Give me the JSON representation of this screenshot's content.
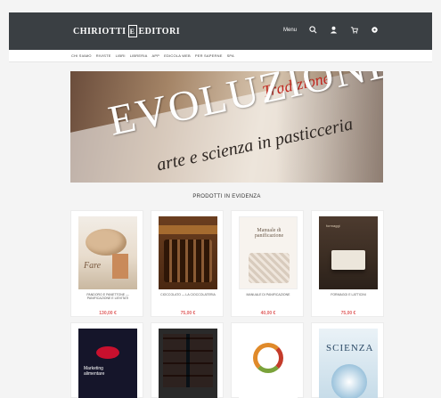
{
  "header": {
    "logo_text_left": "CHIRIOTTI",
    "logo_mark": "E",
    "logo_text_right": "EDITORI",
    "menu_label": "Menu",
    "icons": [
      "search-icon",
      "user-icon",
      "cart-icon",
      "settings-icon"
    ]
  },
  "nav": {
    "items": [
      "Chi siamo",
      "Riviste",
      "Libri",
      "Libreria",
      "App",
      "Edicola web",
      "Per saperne",
      "SPA"
    ]
  },
  "hero": {
    "line_top": "Tradizione",
    "line_big": "EVOLUZIONE",
    "line_sub": "arte e scienza in pasticceria"
  },
  "section": {
    "title": "PRODOTTI IN EVIDENZA"
  },
  "products": [
    {
      "title": "PANDORO E PANETTONE — PANIFICAZIONE E LIEVITATI",
      "price": "130,00 €"
    },
    {
      "title": "CIOCCOLATO — LA CIOCCOLATERIA",
      "price": "75,00 €"
    },
    {
      "title": "MANUALE DI PANIFICAZIONE",
      "price": "40,00 €"
    },
    {
      "title": "FORMAGGI E LATTICINI",
      "price": "75,00 €"
    },
    {
      "title": "",
      "price": ""
    },
    {
      "title": "",
      "price": ""
    },
    {
      "title": "",
      "price": ""
    },
    {
      "title": "SCIENZA",
      "price": ""
    }
  ],
  "colors": {
    "topbar": "#3a3f43",
    "price": "#e06060",
    "background": "#f4f4f4"
  }
}
